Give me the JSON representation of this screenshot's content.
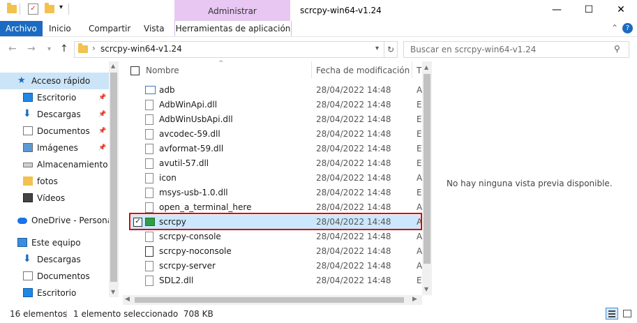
{
  "window": {
    "title": "scrcpy-win64-v1.24",
    "contextual_tab_group": "Administrar",
    "controls": {
      "minimize": "—",
      "maximize": "☐",
      "close": "✕"
    }
  },
  "ribbon": {
    "tabs": [
      {
        "label": "Archivo"
      },
      {
        "label": "Inicio"
      },
      {
        "label": "Compartir"
      },
      {
        "label": "Vista"
      },
      {
        "label": "Herramientas de aplicación"
      }
    ],
    "collapse_icon": "⌃",
    "help_icon": "?"
  },
  "address": {
    "path_separator": "›",
    "path": "scrcpy-win64-v1.24",
    "search_placeholder": "Buscar en scrcpy-win64-v1.24"
  },
  "nav_pane": {
    "items": [
      {
        "label": "Acceso rápido",
        "icon": "star-icon",
        "level": 0,
        "pinned": false,
        "selected": true
      },
      {
        "label": "Escritorio",
        "icon": "desktop-icon",
        "level": 1,
        "pinned": true
      },
      {
        "label": "Descargas",
        "icon": "download-icon",
        "level": 1,
        "pinned": true
      },
      {
        "label": "Documentos",
        "icon": "document-icon",
        "level": 1,
        "pinned": true
      },
      {
        "label": "Imágenes",
        "icon": "image-icon",
        "level": 1,
        "pinned": true
      },
      {
        "label": "Almacenamiento ir",
        "icon": "drive-icon",
        "level": 1,
        "pinned": false
      },
      {
        "label": "fotos",
        "icon": "folder-icon",
        "level": 1,
        "pinned": false
      },
      {
        "label": "Vídeos",
        "icon": "video-icon",
        "level": 1,
        "pinned": false
      },
      {
        "label": "OneDrive - Personal",
        "icon": "cloud-icon",
        "level": 0,
        "pinned": false
      },
      {
        "label": "Este equipo",
        "icon": "computer-icon",
        "level": 0,
        "pinned": false
      },
      {
        "label": "Descargas",
        "icon": "download-icon",
        "level": 1,
        "pinned": false
      },
      {
        "label": "Documentos",
        "icon": "document-icon",
        "level": 1,
        "pinned": false
      },
      {
        "label": "Escritorio",
        "icon": "desktop-icon",
        "level": 1,
        "pinned": false
      }
    ]
  },
  "file_list": {
    "columns": {
      "name": "Nombre",
      "date": "Fecha de modificación",
      "type": "Ti"
    },
    "files": [
      {
        "name": "adb",
        "date": "28/04/2022 14:48",
        "type": "A",
        "icon": "exe-icon"
      },
      {
        "name": "AdbWinApi.dll",
        "date": "28/04/2022 14:48",
        "type": "Ex",
        "icon": "dll-icon"
      },
      {
        "name": "AdbWinUsbApi.dll",
        "date": "28/04/2022 14:48",
        "type": "Ex",
        "icon": "dll-icon"
      },
      {
        "name": "avcodec-59.dll",
        "date": "28/04/2022 14:48",
        "type": "Ex",
        "icon": "dll-icon"
      },
      {
        "name": "avformat-59.dll",
        "date": "28/04/2022 14:48",
        "type": "Ex",
        "icon": "dll-icon"
      },
      {
        "name": "avutil-57.dll",
        "date": "28/04/2022 14:48",
        "type": "Ex",
        "icon": "dll-icon"
      },
      {
        "name": "icon",
        "date": "28/04/2022 14:48",
        "type": "A",
        "icon": "file-icon"
      },
      {
        "name": "msys-usb-1.0.dll",
        "date": "28/04/2022 14:48",
        "type": "Ex",
        "icon": "dll-icon"
      },
      {
        "name": "open_a_terminal_here",
        "date": "28/04/2022 14:48",
        "type": "A",
        "icon": "gear-file-icon"
      },
      {
        "name": "scrcpy",
        "date": "28/04/2022 14:48",
        "type": "A",
        "icon": "app-icon",
        "selected": true
      },
      {
        "name": "scrcpy-console",
        "date": "28/04/2022 14:48",
        "type": "A",
        "icon": "gear-file-icon"
      },
      {
        "name": "scrcpy-noconsole",
        "date": "28/04/2022 14:48",
        "type": "A",
        "icon": "script-icon"
      },
      {
        "name": "scrcpy-server",
        "date": "28/04/2022 14:48",
        "type": "A",
        "icon": "file-icon"
      },
      {
        "name": "SDL2.dll",
        "date": "28/04/2022 14:48",
        "type": "Ex",
        "icon": "dll-icon"
      }
    ]
  },
  "preview": {
    "message": "No hay ninguna vista previa disponible."
  },
  "status_bar": {
    "item_count": "16 elementos",
    "selection": "1 elemento seleccionado  708 KB"
  },
  "colors": {
    "accent": "#1a6bc1",
    "context_tab": "#e8c7f2",
    "selection": "#cce8ff",
    "highlight_outline": "#d50000"
  }
}
